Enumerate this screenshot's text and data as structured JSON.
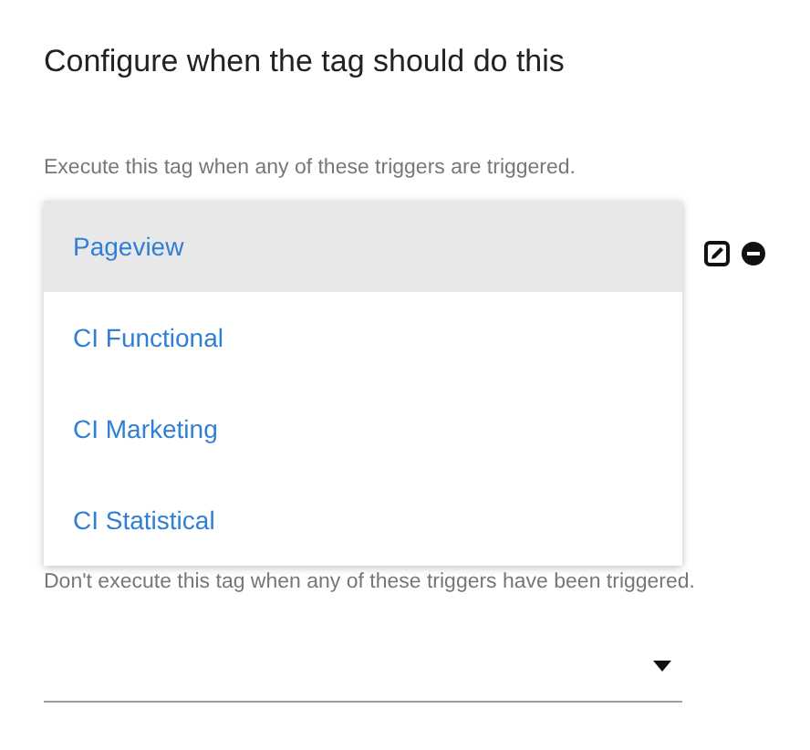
{
  "heading": "Configure when the tag should do this",
  "execute_section": {
    "description": "Execute this tag when any of these triggers are triggered.",
    "trigger_menu": {
      "items": [
        {
          "label": "Pageview",
          "selected": true
        },
        {
          "label": "CI Functional",
          "selected": false
        },
        {
          "label": "CI Marketing",
          "selected": false
        },
        {
          "label": "CI Statistical",
          "selected": false
        }
      ]
    }
  },
  "exception_section": {
    "description": "Don't execute this tag when any of these triggers have been triggered."
  }
}
